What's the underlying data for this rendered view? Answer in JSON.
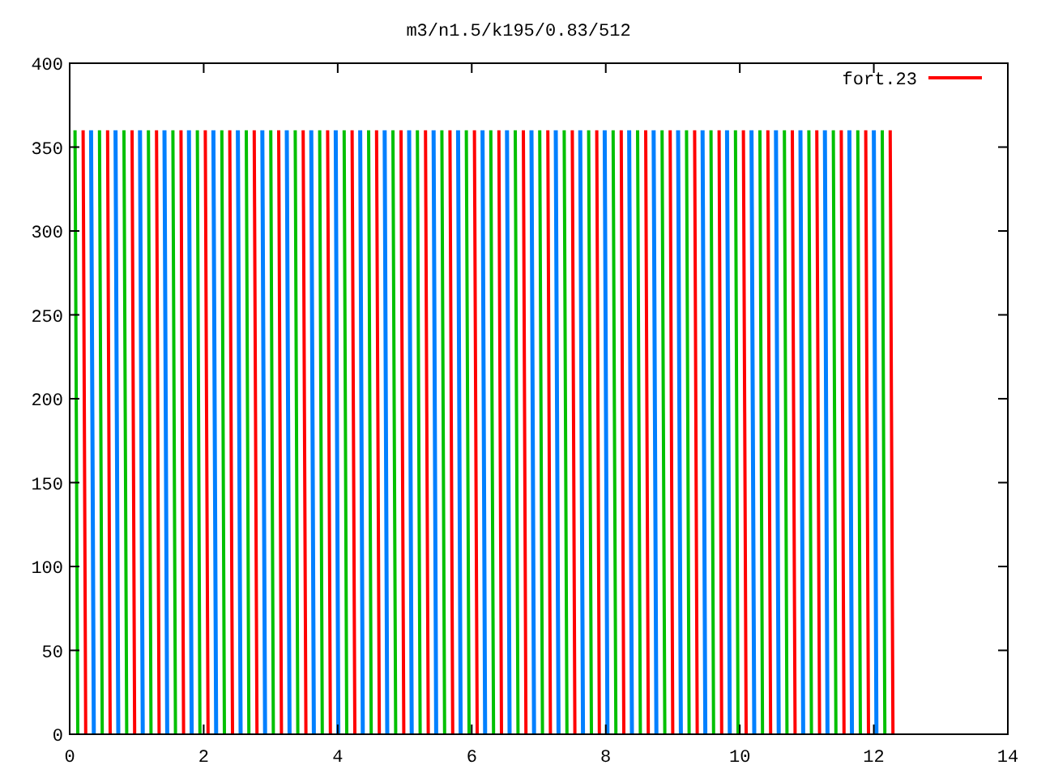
{
  "chart": {
    "title": "m3/n1.5/k195/0.83/512",
    "yticks": [
      "400",
      "350",
      "300",
      "250",
      "200",
      "150",
      "100",
      "50",
      "0"
    ],
    "xticks": [
      "0",
      "2",
      "4",
      "6",
      "8",
      "10",
      "12",
      "14"
    ],
    "legend": {
      "label": "fort.23",
      "color": "#ff0000"
    }
  }
}
